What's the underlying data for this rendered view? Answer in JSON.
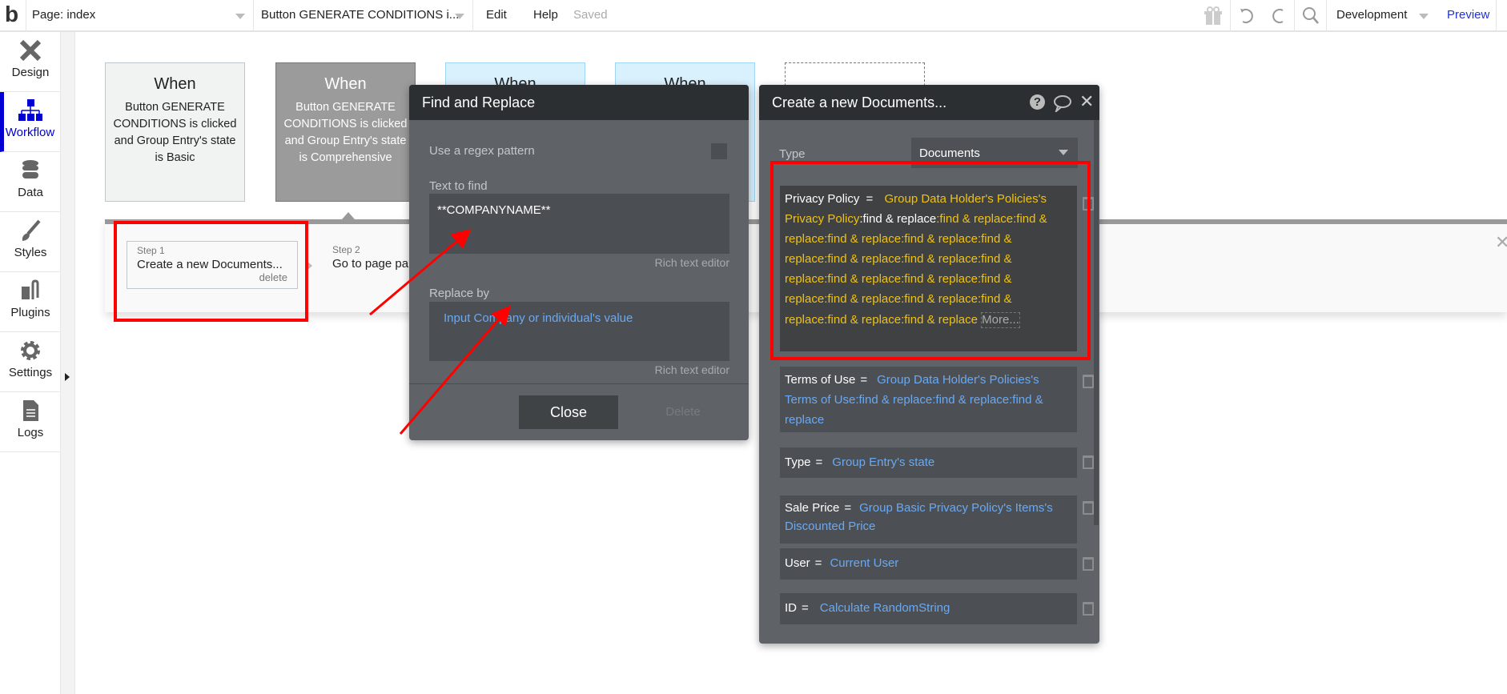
{
  "topbar": {
    "logo": "b",
    "page": "Page: index",
    "element": "Button GENERATE CONDITIONS i...",
    "edit": "Edit",
    "help": "Help",
    "saved": "Saved",
    "environment": "Development",
    "preview": "Preview"
  },
  "sidebar": {
    "items": [
      {
        "label": "Design",
        "icon": "design-tools-icon"
      },
      {
        "label": "Workflow",
        "icon": "workflow-tree-icon",
        "active": true
      },
      {
        "label": "Data",
        "icon": "database-icon"
      },
      {
        "label": "Styles",
        "icon": "brush-icon"
      },
      {
        "label": "Plugins",
        "icon": "plug-icon"
      },
      {
        "label": "Settings",
        "icon": "gear-icon"
      },
      {
        "label": "Logs",
        "icon": "document-icon"
      }
    ]
  },
  "events": [
    {
      "when": "When",
      "text": "Button GENERATE CONDITIONS is clicked and Group Entry's state is Basic"
    },
    {
      "when": "When",
      "text": "Button GENERATE CONDITIONS is clicked and Group Entry's state is Comprehensive"
    },
    {
      "when": "When"
    },
    {
      "when": "When"
    }
  ],
  "steps": [
    {
      "step": "Step 1",
      "title": "Create a new Documents...",
      "delete": "delete"
    },
    {
      "step": "Step 2",
      "title": "Go to page pa"
    }
  ],
  "find_replace": {
    "title": "Find and Replace",
    "regex_label": "Use a regex pattern",
    "regex_checked": false,
    "text_to_find_label": "Text to find",
    "text_to_find": "**COMPANYNAME**",
    "rich1": "Rich text editor",
    "replace_by_label": "Replace by",
    "replace_by": "Input Company or individual's value",
    "rich2": "Rich text editor",
    "close": "Close",
    "delete": "Delete"
  },
  "create_panel": {
    "title": "Create a new Documents...",
    "type_label": "Type",
    "type_value": "Documents",
    "privacy": {
      "key": "Privacy Policy",
      "eq": "=",
      "seg1": "Group Data Holder's Policies's Privacy Policy",
      "seg2": ":find & replace",
      "seg3": ":find & replace:find & replace:find & replace:find & replace:find & replace:find & replace:find & replace:find & replace:find & replace:find & replace:find & replace:find & replace:find & replace:find & replace:find & replace:find & replace",
      "more": "More..."
    },
    "fields": [
      {
        "key": "Terms of Use",
        "eq": "=",
        "value": "Group Data Holder's Policies's Terms of Use:find & replace:find & replace:find & replace"
      },
      {
        "key": "Type",
        "eq": "=",
        "value": "Group Entry's state"
      },
      {
        "key": "Sale Price",
        "eq": "=",
        "value": "Group Basic Privacy Policy's Items's Discounted Price"
      },
      {
        "key": "User",
        "eq": "=",
        "value": "Current User"
      },
      {
        "key": "ID",
        "eq": "=",
        "value": "Calculate RandomString"
      }
    ]
  },
  "colors": {
    "accent": "#0000d4",
    "annotation": "#ff0000",
    "expression_yellow": "#f0c20f",
    "expression_blue": "#6aa9f2"
  }
}
